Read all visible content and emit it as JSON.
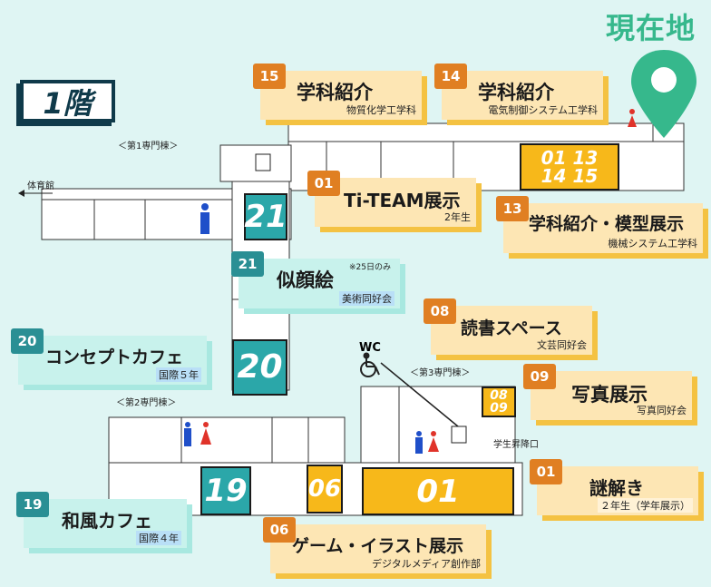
{
  "floor_label": "1階",
  "current_location": "現在地",
  "building_labels": {
    "bldg1": "＜第1専門棟＞",
    "bldg2": "＜第2専門棟＞",
    "bldg3": "＜第3専門棟＞",
    "gym": "体育館",
    "student_exit": "学生昇降口",
    "wc": "WC",
    "note_25": "※25日のみ"
  },
  "room_tags": {
    "r21": "21",
    "r20": "20",
    "r19": "19",
    "r06": "06",
    "r01": "01",
    "r0809_a": "08",
    "r0809_b": "09",
    "r0113_a": "01 13",
    "r0113_b": "14 15"
  },
  "exhibits": [
    {
      "id": "15",
      "title": "学科紹介",
      "sub": "物質化学工学科"
    },
    {
      "id": "14",
      "title": "学科紹介",
      "sub": "電気制御システム工学科"
    },
    {
      "id": "01",
      "title": "Ti-TEAM展示",
      "sub": "2年生"
    },
    {
      "id": "13",
      "title": "学科紹介・模型展示",
      "sub": "機械システム工学科"
    },
    {
      "id": "21",
      "title": "似顔絵",
      "sub": "美術同好会"
    },
    {
      "id": "08",
      "title": "読書スペース",
      "sub": "文芸同好会"
    },
    {
      "id": "20",
      "title": "コンセプトカフェ",
      "sub": "国際５年"
    },
    {
      "id": "09",
      "title": "写真展示",
      "sub": "写真同好会"
    },
    {
      "id": "01",
      "title": "謎解き",
      "sub": "２年生（学年展示）"
    },
    {
      "id": "19",
      "title": "和風カフェ",
      "sub": "国際４年"
    },
    {
      "id": "06",
      "title": "ゲーム・イラスト展示",
      "sub": "デジタルメディア創作部"
    }
  ],
  "colors": {
    "background": "#dff5f3",
    "orange": "#e07f22",
    "teal": "#2a8f94",
    "gold": "#f7b81a",
    "pin": "#36b88c"
  },
  "icons": [
    "location-pin-icon",
    "male-restroom-icon",
    "female-restroom-icon",
    "wheelchair-icon",
    "elevator-icon",
    "arrow-left-icon"
  ]
}
